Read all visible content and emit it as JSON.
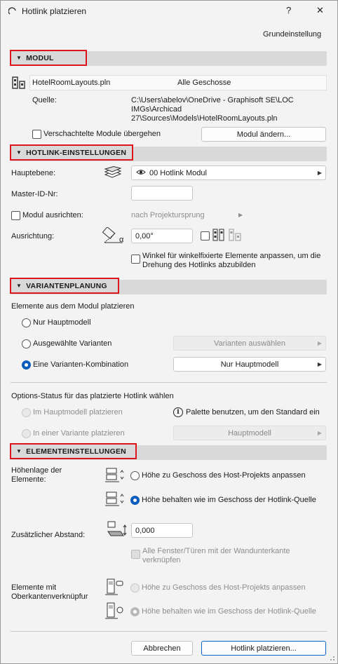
{
  "title": "Hotlink platzieren",
  "help_glyph": "?",
  "close_glyph": "✕",
  "settings_link": "Grundeinstellung",
  "modul": {
    "header": "MODUL",
    "file": "HotelRoomLayouts.pln",
    "stories": "Alle Geschosse",
    "source_label": "Quelle:",
    "source_lines": [
      "C:\\Users\\abelov\\OneDrive - Graphisoft SE\\LOC",
      "IMGs\\Archicad",
      "27\\Sources\\Models\\HotelRoomLayouts.pln"
    ],
    "skip_nested": "Verschachtelte Module übergehen",
    "change_button": "Modul ändern..."
  },
  "hotlink": {
    "header": "HOTLINK-EINSTELLUNGEN",
    "main_layer_label": "Hauptebene:",
    "main_layer_value": "00 Hotlink Modul",
    "master_id_label": "Master-ID-Nr:",
    "master_id_value": "",
    "align_label": "Modul ausrichten:",
    "align_value": "nach Projektursprung",
    "orientation_label": "Ausrichtung:",
    "orientation_value": "0,00°",
    "alpha": "α",
    "angle_text": "Winkel für winkelfixierte Elemente anpassen, um die Drehung des Hotlinks abzubilden"
  },
  "varianten": {
    "header": "VARIANTENPLANUNG",
    "place_label": "Elemente aus dem Modul platzieren",
    "opt_main": "Nur Hauptmodell",
    "opt_selected": "Ausgewählte Varianten",
    "select_button": "Varianten auswählen",
    "opt_combo": "Eine Varianten-Kombination",
    "combo_value": "Nur Hauptmodell",
    "options_label": "Options-Status für das platzierte Hotlink wählen",
    "opt_place_main": "Im Hauptmodell platzieren",
    "info_glyph": "i",
    "info_text": "Palette benutzen, um den Standard ein",
    "opt_place_variant": "In einer Variante platzieren",
    "variant_value": "Hauptmodell"
  },
  "elemente": {
    "header": "ELEMENTEINSTELLUNGEN",
    "height_label": "Höhenlage der Elemente:",
    "height_opt1": "Höhe zu Geschoss des Host-Projekts anpassen",
    "height_opt2": "Höhe behalten wie im Geschoss der Hotlink-Quelle",
    "offset_label": "Zusätzlicher Abstand:",
    "offset_value": "0,000",
    "windows_text": "Alle Fenster/Türen mit der Wandunterkante verknüpfen",
    "top_label": "Elemente mit Oberkantenverknüpfur",
    "top_opt1": "Höhe zu Geschoss des Host-Projekts anpassen",
    "top_opt2": "Höhe behalten wie im Geschoss der Hotlink-Quelle"
  },
  "footer": {
    "cancel": "Abbrechen",
    "place": "Hotlink platzieren..."
  },
  "colors": {
    "accent": "#0b5cbd",
    "highlight_red": "#e0141c",
    "section_bg": "#d9d9d9"
  }
}
